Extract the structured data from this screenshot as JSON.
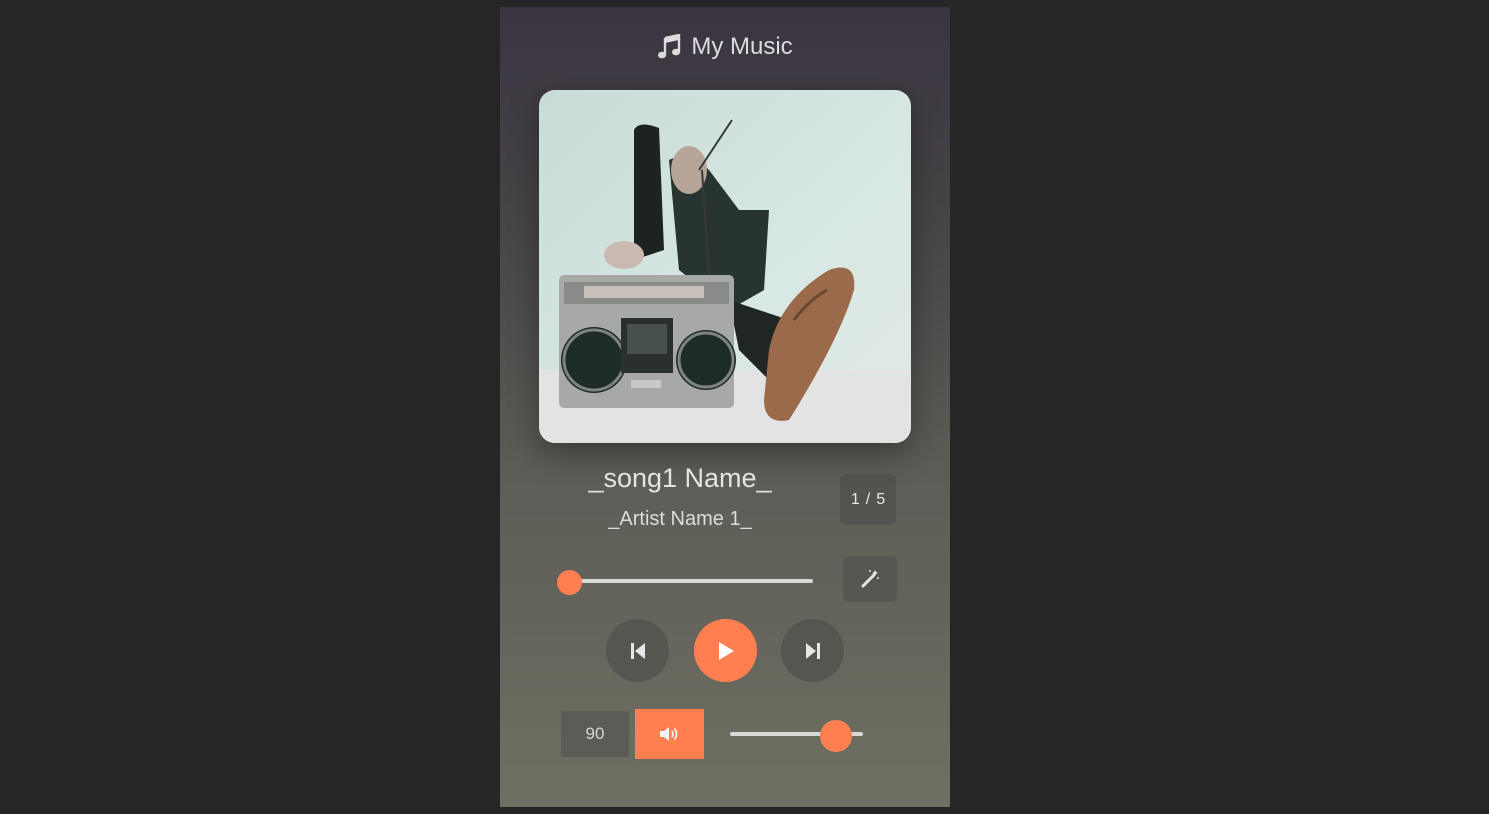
{
  "header": {
    "icon": "music-note-icon",
    "title": "My Music"
  },
  "album_art": {
    "description_icon": "album-cover"
  },
  "track": {
    "title": "_song1 Name_",
    "artist": "_Artist Name 1_",
    "index": "1",
    "separator": "/",
    "total": "5"
  },
  "seek": {
    "progress_fraction": 0.0
  },
  "controls": {
    "prev_icon": "skip-previous-icon",
    "play_icon": "play-icon",
    "next_icon": "skip-next-icon",
    "magic_icon": "magic-wand-icon",
    "volume_icon": "volume-icon"
  },
  "volume": {
    "value": "90",
    "level_fraction": 0.9
  },
  "colors": {
    "accent": "#ff7f50",
    "background": "#262626"
  }
}
